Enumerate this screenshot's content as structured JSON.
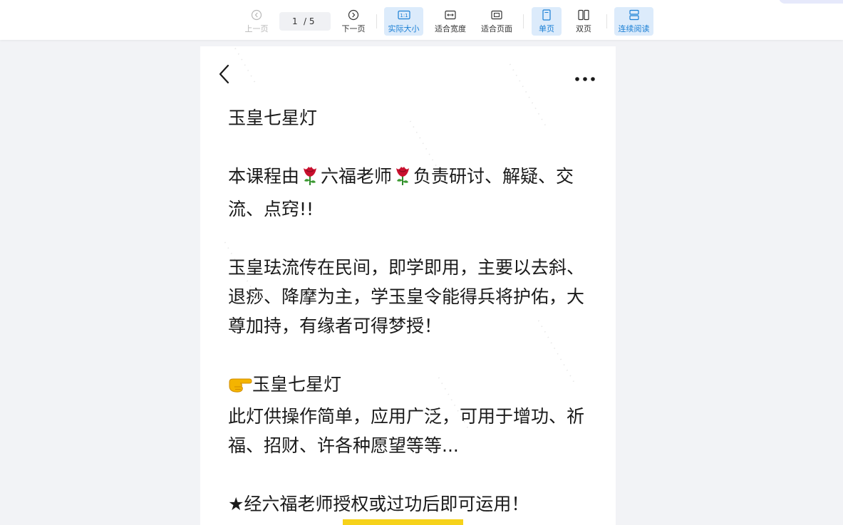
{
  "toolbar": {
    "prev_label": "上一页",
    "next_label": "下一页",
    "current_page": "1",
    "total_pages": "/ 5",
    "actual_size_label": "实际大小",
    "fit_width_label": "适合宽度",
    "fit_page_label": "适合页面",
    "single_page_label": "单页",
    "double_page_label": "双页",
    "continuous_label": "连续阅读"
  },
  "document": {
    "title": "玉皇七星灯",
    "intro_part1": "本课程由",
    "intro_teacher": "六福老师",
    "intro_part2": "负责研讨、解疑、交流、点窍!!",
    "para2": "玉皇珐流传在民间，即学即用，主要以去斜、退痧、降摩为主，学玉皇令能得兵将护佑，大尊加持，有缘者可得梦授！",
    "section_title": "玉皇七星灯",
    "section_body": "此灯供操作简单，应用广泛，可用于增功、祈福、招财、许各种愿望等等...",
    "final_line": "★经六福老师授权或过功后即可运用！"
  },
  "colors": {
    "accent": "#1a7fd4",
    "active_bg": "#dcebfb",
    "page_bg": "#f2f3f6",
    "yellow_block": "#f6d21a"
  },
  "icons": [
    "prev-page-icon",
    "next-page-icon",
    "actual-size-icon",
    "fit-width-icon",
    "fit-page-icon",
    "single-page-icon",
    "double-page-icon",
    "continuous-read-icon",
    "back-arrow-icon",
    "more-options-icon",
    "rose-icon",
    "pointing-finger-icon"
  ]
}
